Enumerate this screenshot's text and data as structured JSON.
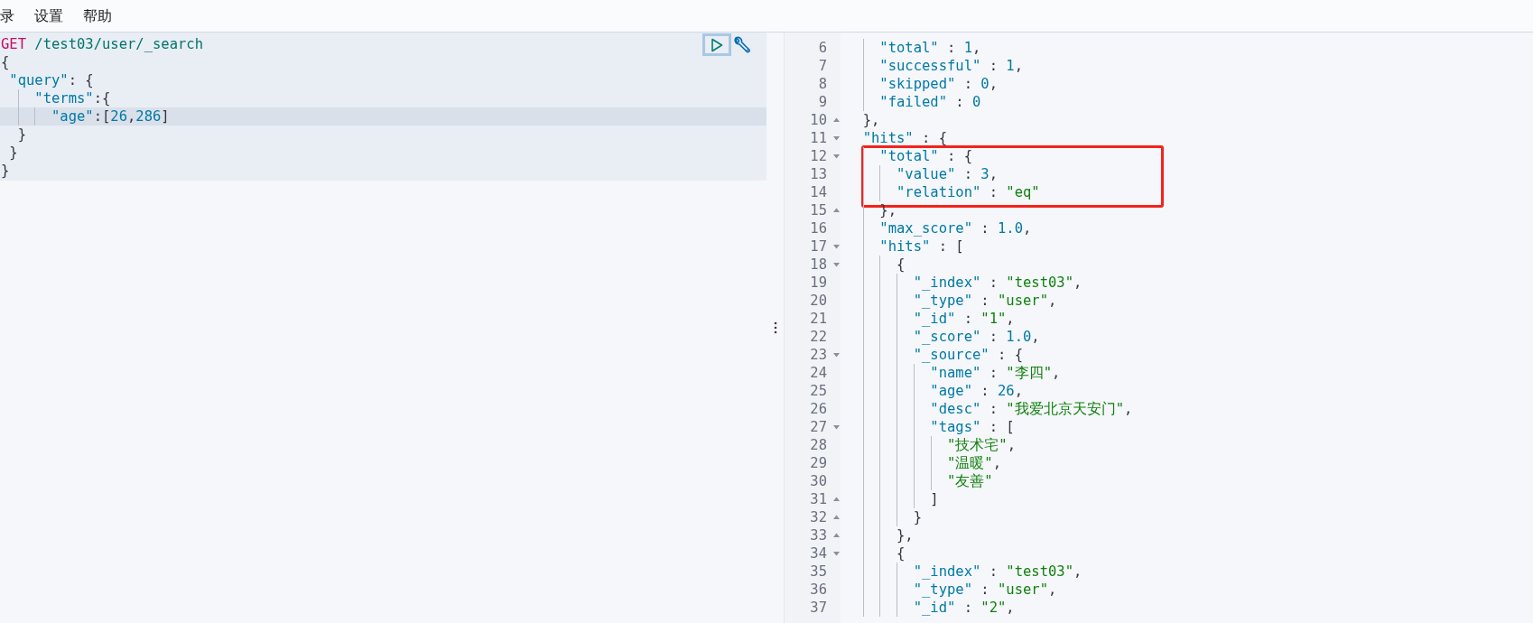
{
  "menu": [
    {
      "label": "录"
    },
    {
      "label": "设置"
    },
    {
      "label": "帮助"
    }
  ],
  "request": {
    "lines": [
      {
        "active": false,
        "t": [
          {
            "kind": "method",
            "text": "GET"
          },
          {
            "kind": "url",
            "text": " /test03/user/_search"
          }
        ]
      },
      {
        "active": false,
        "t": [
          {
            "kind": "punct",
            "text": "{"
          }
        ]
      },
      {
        "active": false,
        "t": [
          {
            "kind": "key",
            "text": " \"query\""
          },
          {
            "kind": "punct",
            "text": ": {"
          }
        ]
      },
      {
        "active": false,
        "t": [
          {
            "kind": "key",
            "text": "    \"terms\""
          },
          {
            "kind": "punct",
            "text": ":{"
          }
        ]
      },
      {
        "active": true,
        "t": [
          {
            "kind": "key",
            "text": "      \"age\""
          },
          {
            "kind": "punct",
            "text": ":["
          },
          {
            "kind": "number",
            "text": "26"
          },
          {
            "kind": "punct",
            "text": ","
          },
          {
            "kind": "number",
            "text": "286"
          },
          {
            "kind": "punct",
            "text": "]"
          }
        ]
      },
      {
        "active": false,
        "t": [
          {
            "kind": "punct",
            "text": "  }"
          }
        ]
      },
      {
        "active": false,
        "t": [
          {
            "kind": "punct",
            "text": " }"
          }
        ]
      },
      {
        "active": false,
        "t": [
          {
            "kind": "punct",
            "text": "}"
          }
        ]
      }
    ]
  },
  "response": {
    "lines": [
      {
        "n": "6",
        "boxed": false,
        "t": [
          {
            "kind": "key",
            "text": "    \"total\""
          },
          {
            "kind": "punct",
            "text": " : "
          },
          {
            "kind": "number",
            "text": "1"
          },
          {
            "kind": "punct",
            "text": ","
          }
        ]
      },
      {
        "n": "7",
        "boxed": false,
        "t": [
          {
            "kind": "key",
            "text": "    \"successful\""
          },
          {
            "kind": "punct",
            "text": " : "
          },
          {
            "kind": "number",
            "text": "1"
          },
          {
            "kind": "punct",
            "text": ","
          }
        ]
      },
      {
        "n": "8",
        "boxed": false,
        "t": [
          {
            "kind": "key",
            "text": "    \"skipped\""
          },
          {
            "kind": "punct",
            "text": " : "
          },
          {
            "kind": "number",
            "text": "0"
          },
          {
            "kind": "punct",
            "text": ","
          }
        ]
      },
      {
        "n": "9",
        "boxed": false,
        "t": [
          {
            "kind": "key",
            "text": "    \"failed\""
          },
          {
            "kind": "punct",
            "text": " : "
          },
          {
            "kind": "number",
            "text": "0"
          }
        ]
      },
      {
        "n": "10",
        "kind": "fold_end",
        "boxed": false,
        "t": [
          {
            "kind": "punct",
            "text": "  },"
          }
        ]
      },
      {
        "n": "11",
        "kind": "fold_start",
        "boxed": false,
        "t": [
          {
            "kind": "key",
            "text": "  \"hits\""
          },
          {
            "kind": "punct",
            "text": " : {"
          }
        ]
      },
      {
        "n": "12",
        "kind": "fold_start",
        "boxed": true,
        "t": [
          {
            "kind": "key",
            "text": "    \"total\""
          },
          {
            "kind": "punct",
            "text": " : {"
          }
        ]
      },
      {
        "n": "13",
        "boxed": true,
        "t": [
          {
            "kind": "key",
            "text": "      \"value\""
          },
          {
            "kind": "punct",
            "text": " : "
          },
          {
            "kind": "number",
            "text": "3"
          },
          {
            "kind": "punct",
            "text": ","
          }
        ]
      },
      {
        "n": "14",
        "boxed": true,
        "t": [
          {
            "kind": "key",
            "text": "      \"relation\""
          },
          {
            "kind": "punct",
            "text": " : "
          },
          {
            "kind": "string",
            "text": "\"eq\""
          }
        ]
      },
      {
        "n": "15",
        "kind": "fold_end",
        "boxed": false,
        "t": [
          {
            "kind": "punct",
            "text": "    },"
          }
        ]
      },
      {
        "n": "16",
        "boxed": false,
        "t": [
          {
            "kind": "key",
            "text": "    \"max_score\""
          },
          {
            "kind": "punct",
            "text": " : "
          },
          {
            "kind": "number",
            "text": "1.0"
          },
          {
            "kind": "punct",
            "text": ","
          }
        ]
      },
      {
        "n": "17",
        "kind": "fold_start",
        "boxed": false,
        "t": [
          {
            "kind": "key",
            "text": "    \"hits\""
          },
          {
            "kind": "punct",
            "text": " : ["
          }
        ]
      },
      {
        "n": "18",
        "kind": "fold_start",
        "boxed": false,
        "t": [
          {
            "kind": "punct",
            "text": "      {"
          }
        ]
      },
      {
        "n": "19",
        "boxed": false,
        "t": [
          {
            "kind": "key",
            "text": "        \"_index\""
          },
          {
            "kind": "punct",
            "text": " : "
          },
          {
            "kind": "string",
            "text": "\"test03\""
          },
          {
            "kind": "punct",
            "text": ","
          }
        ]
      },
      {
        "n": "20",
        "boxed": false,
        "t": [
          {
            "kind": "key",
            "text": "        \"_type\""
          },
          {
            "kind": "punct",
            "text": " : "
          },
          {
            "kind": "string",
            "text": "\"user\""
          },
          {
            "kind": "punct",
            "text": ","
          }
        ]
      },
      {
        "n": "21",
        "boxed": false,
        "t": [
          {
            "kind": "key",
            "text": "        \"_id\""
          },
          {
            "kind": "punct",
            "text": " : "
          },
          {
            "kind": "string",
            "text": "\"1\""
          },
          {
            "kind": "punct",
            "text": ","
          }
        ]
      },
      {
        "n": "22",
        "boxed": false,
        "t": [
          {
            "kind": "key",
            "text": "        \"_score\""
          },
          {
            "kind": "punct",
            "text": " : "
          },
          {
            "kind": "number",
            "text": "1.0"
          },
          {
            "kind": "punct",
            "text": ","
          }
        ]
      },
      {
        "n": "23",
        "kind": "fold_start",
        "boxed": false,
        "t": [
          {
            "kind": "key",
            "text": "        \"_source\""
          },
          {
            "kind": "punct",
            "text": " : {"
          }
        ]
      },
      {
        "n": "24",
        "boxed": false,
        "t": [
          {
            "kind": "key",
            "text": "          \"name\""
          },
          {
            "kind": "punct",
            "text": " : "
          },
          {
            "kind": "string",
            "text": "\"李四\""
          },
          {
            "kind": "punct",
            "text": ","
          }
        ]
      },
      {
        "n": "25",
        "boxed": false,
        "t": [
          {
            "kind": "key",
            "text": "          \"age\""
          },
          {
            "kind": "punct",
            "text": " : "
          },
          {
            "kind": "number",
            "text": "26"
          },
          {
            "kind": "punct",
            "text": ","
          }
        ]
      },
      {
        "n": "26",
        "boxed": false,
        "t": [
          {
            "kind": "key",
            "text": "          \"desc\""
          },
          {
            "kind": "punct",
            "text": " : "
          },
          {
            "kind": "string",
            "text": "\"我爱北京天安门\""
          },
          {
            "kind": "punct",
            "text": ","
          }
        ]
      },
      {
        "n": "27",
        "kind": "fold_start",
        "boxed": false,
        "t": [
          {
            "kind": "key",
            "text": "          \"tags\""
          },
          {
            "kind": "punct",
            "text": " : ["
          }
        ]
      },
      {
        "n": "28",
        "boxed": false,
        "t": [
          {
            "kind": "string",
            "text": "            \"技术宅\""
          },
          {
            "kind": "punct",
            "text": ","
          }
        ]
      },
      {
        "n": "29",
        "boxed": false,
        "t": [
          {
            "kind": "string",
            "text": "            \"温暖\""
          },
          {
            "kind": "punct",
            "text": ","
          }
        ]
      },
      {
        "n": "30",
        "boxed": false,
        "t": [
          {
            "kind": "string",
            "text": "            \"友善\""
          }
        ]
      },
      {
        "n": "31",
        "kind": "fold_end",
        "boxed": false,
        "t": [
          {
            "kind": "punct",
            "text": "          ]"
          }
        ]
      },
      {
        "n": "32",
        "kind": "fold_end",
        "boxed": false,
        "t": [
          {
            "kind": "punct",
            "text": "        }"
          }
        ]
      },
      {
        "n": "33",
        "kind": "fold_end",
        "boxed": false,
        "t": [
          {
            "kind": "punct",
            "text": "      },"
          }
        ]
      },
      {
        "n": "34",
        "kind": "fold_start",
        "boxed": false,
        "t": [
          {
            "kind": "punct",
            "text": "      {"
          }
        ]
      },
      {
        "n": "35",
        "boxed": false,
        "t": [
          {
            "kind": "key",
            "text": "        \"_index\""
          },
          {
            "kind": "punct",
            "text": " : "
          },
          {
            "kind": "string",
            "text": "\"test03\""
          },
          {
            "kind": "punct",
            "text": ","
          }
        ]
      },
      {
        "n": "36",
        "boxed": false,
        "t": [
          {
            "kind": "key",
            "text": "        \"_type\""
          },
          {
            "kind": "punct",
            "text": " : "
          },
          {
            "kind": "string",
            "text": "\"user\""
          },
          {
            "kind": "punct",
            "text": ","
          }
        ]
      },
      {
        "n": "37",
        "boxed": false,
        "t": [
          {
            "kind": "key",
            "text": "        \"_id\""
          },
          {
            "kind": "punct",
            "text": " : "
          },
          {
            "kind": "string",
            "text": "\"2\""
          },
          {
            "kind": "punct",
            "text": ","
          }
        ]
      }
    ]
  }
}
